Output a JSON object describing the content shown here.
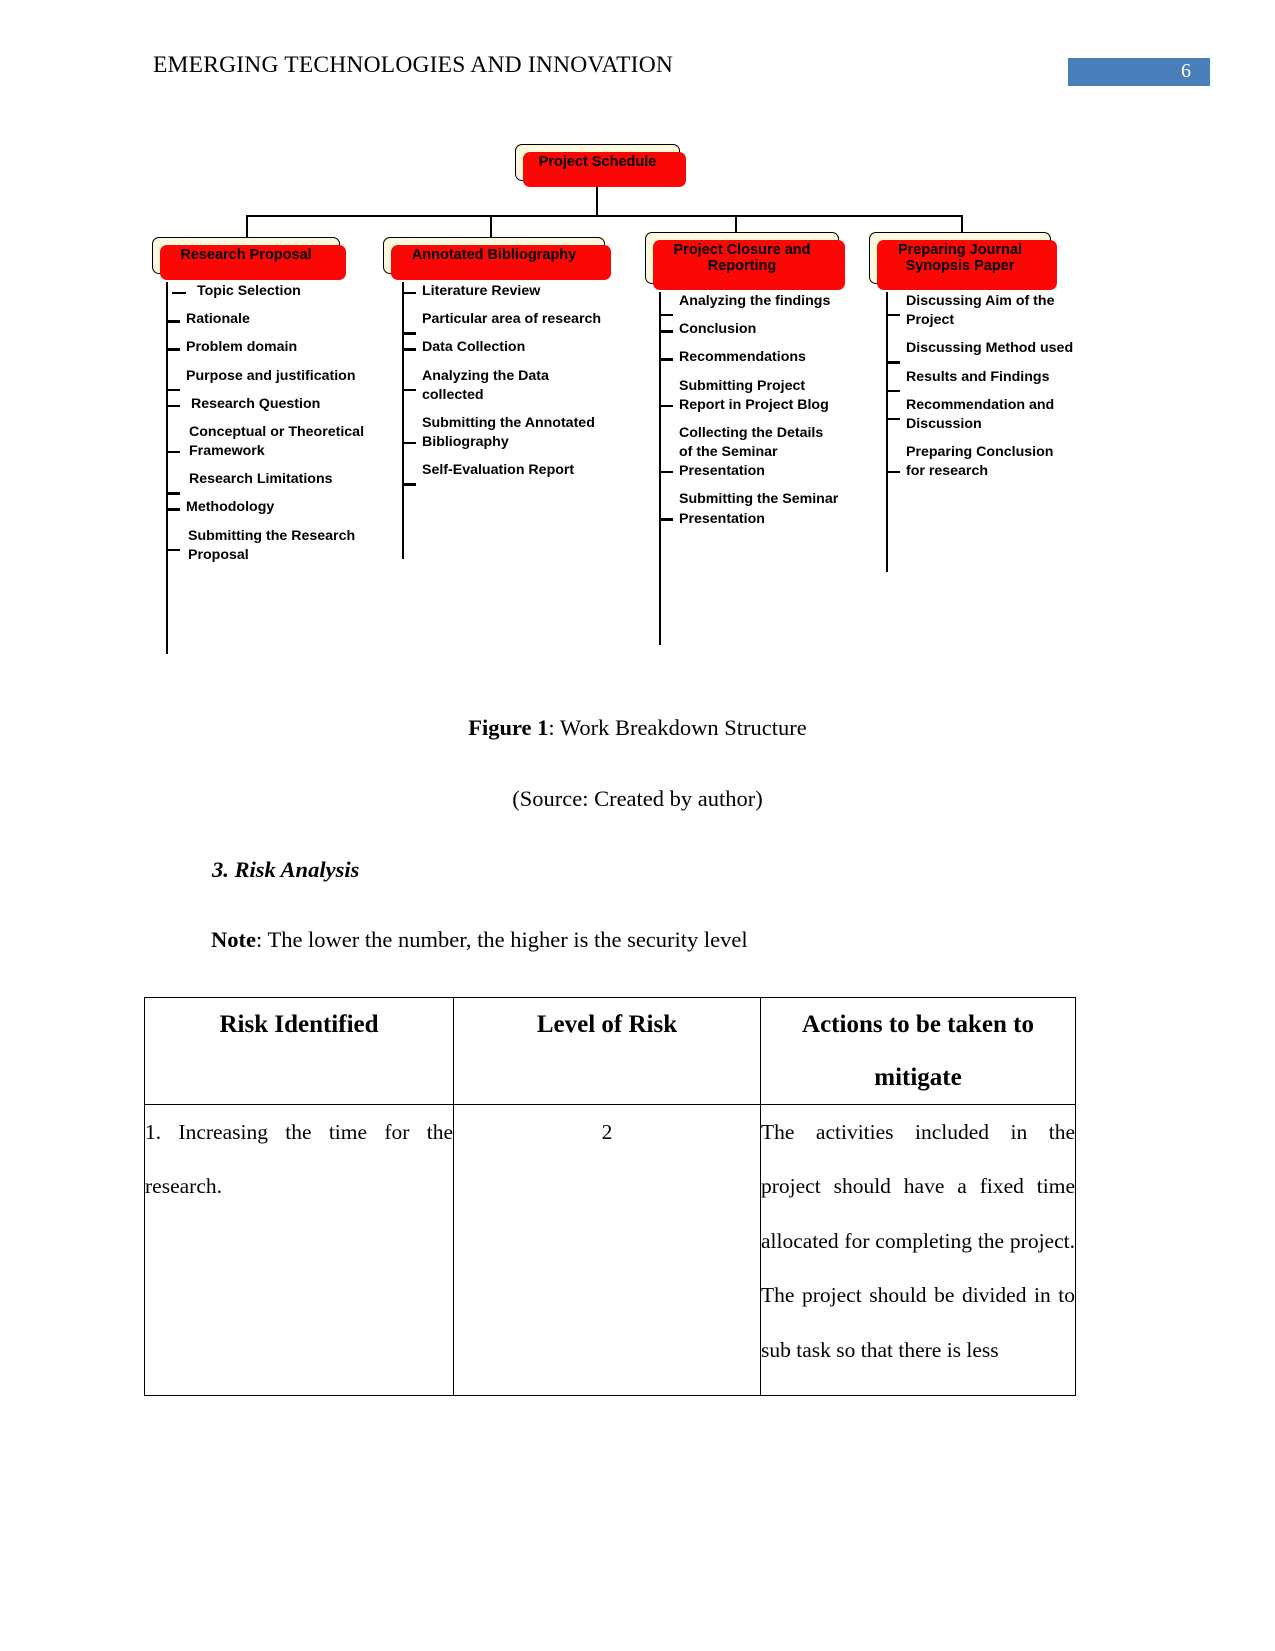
{
  "header": {
    "running_head": "EMERGING TECHNOLOGIES AND INNOVATION",
    "page_number": "6",
    "page_number_bg": "#4a7ebb"
  },
  "figure": {
    "caption_label": "Figure 1",
    "caption_text": ": Work Breakdown Structure",
    "source": "(Source: Created by author)"
  },
  "wbs": {
    "root": "Project Schedule",
    "node_fill": "#fbf8dc",
    "node_shadow": "#fb0806",
    "branches": [
      {
        "title": "Research Proposal",
        "items": [
          "Topic Selection",
          "Rationale",
          "Problem domain",
          "Purpose and justification",
          "Research Question",
          "Conceptual or Theoretical Framework",
          "Research Limitations",
          "Methodology",
          "Submitting the Research Proposal"
        ]
      },
      {
        "title": "Annotated Bibliography",
        "items": [
          "Literature Review",
          "Particular area of research",
          "Data Collection",
          "Analyzing the Data collected",
          "Submitting the Annotated Bibliography",
          "Self-Evaluation Report"
        ]
      },
      {
        "title": "Project Closure and Reporting",
        "items": [
          "Analyzing the findings",
          "Conclusion",
          "Recommendations",
          "Submitting Project Report in Project Blog",
          "Collecting the Details of the Seminar Presentation",
          "Submitting the Seminar Presentation"
        ]
      },
      {
        "title": "Preparing Journal Synopsis Paper",
        "items": [
          "Discussing Aim of the Project",
          "Discussing Method used",
          "Results and Findings",
          "Recommendation and Discussion",
          "Preparing Conclusion for research"
        ]
      }
    ]
  },
  "section": {
    "heading": "3. Risk Analysis",
    "note_label": "Note",
    "note_text": ": The lower the number, the higher is the security level"
  },
  "table": {
    "headers": [
      "Risk Identified",
      "Level of Risk",
      "Actions to be taken to mitigate"
    ],
    "rows": [
      {
        "risk": "1. Increasing the time for the research.",
        "level": "2",
        "action": "The activities included in the project should have a fixed time allocated for completing the project. The project should be divided in to sub task so that there is less"
      }
    ]
  }
}
